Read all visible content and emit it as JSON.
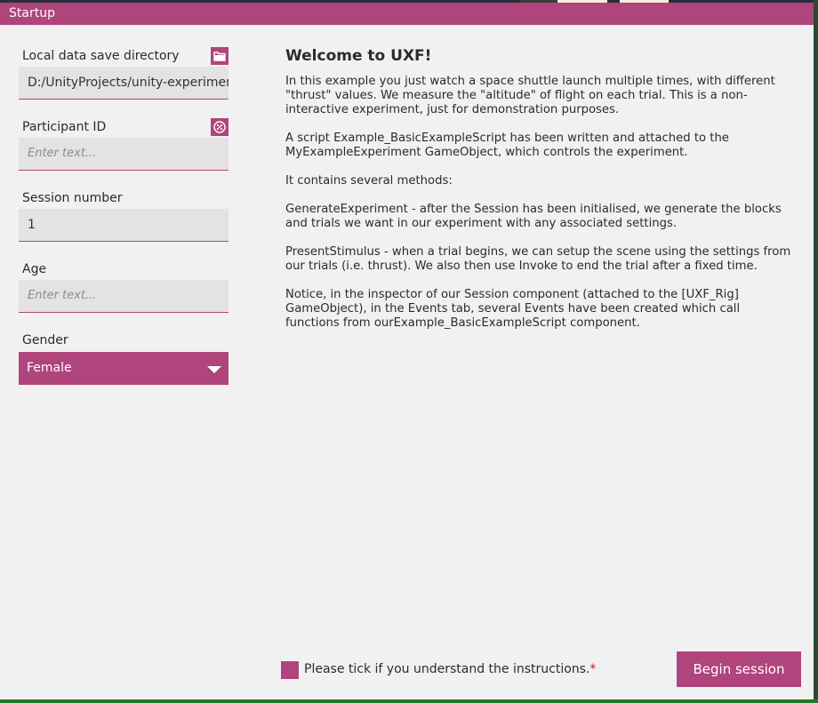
{
  "window": {
    "title": "Startup"
  },
  "form": {
    "save_dir": {
      "label": "Local data save directory",
      "value": "D:/UnityProjects/unity-experiment-",
      "icon": "folder-icon"
    },
    "participant_id": {
      "label": "Participant ID",
      "placeholder": "Enter text...",
      "icon": "dice-icon"
    },
    "session_number": {
      "label": "Session number",
      "value": "1"
    },
    "age": {
      "label": "Age",
      "placeholder": "Enter text..."
    },
    "gender": {
      "label": "Gender",
      "selected": "Female"
    }
  },
  "welcome": {
    "title": "Welcome to UXF!",
    "paragraphs": [
      "In this example you just watch a space shuttle launch multiple times, with different \"thrust\" values. We measure the \"altitude\" of flight on each trial. This is a non-interactive experiment, just for demonstration purposes.",
      "A script Example_BasicExampleScript has been written and attached to the MyExampleExperiment GameObject, which controls the experiment.",
      "It contains several methods:",
      "GenerateExperiment - after the Session has been initialised, we generate the blocks and trials we want in our experiment with any associated settings.",
      "PresentStimulus - when a trial begins, we can setup the scene using the settings from our trials (i.e. thrust). We also then use Invoke to end the trial after a fixed time.",
      "Notice, in the inspector of our Session component (attached to the [UXF_Rig] GameObject), in the Events tab, several Events have been created which call functions from ourExample_BasicExampleScript component."
    ]
  },
  "footer": {
    "checkbox_label": "Please tick if you understand the instructions.",
    "required_mark": "*",
    "begin_label": "Begin session"
  },
  "colors": {
    "accent": "#b0447c",
    "panel": "#f1f1f1",
    "field": "#e3e3e3"
  }
}
